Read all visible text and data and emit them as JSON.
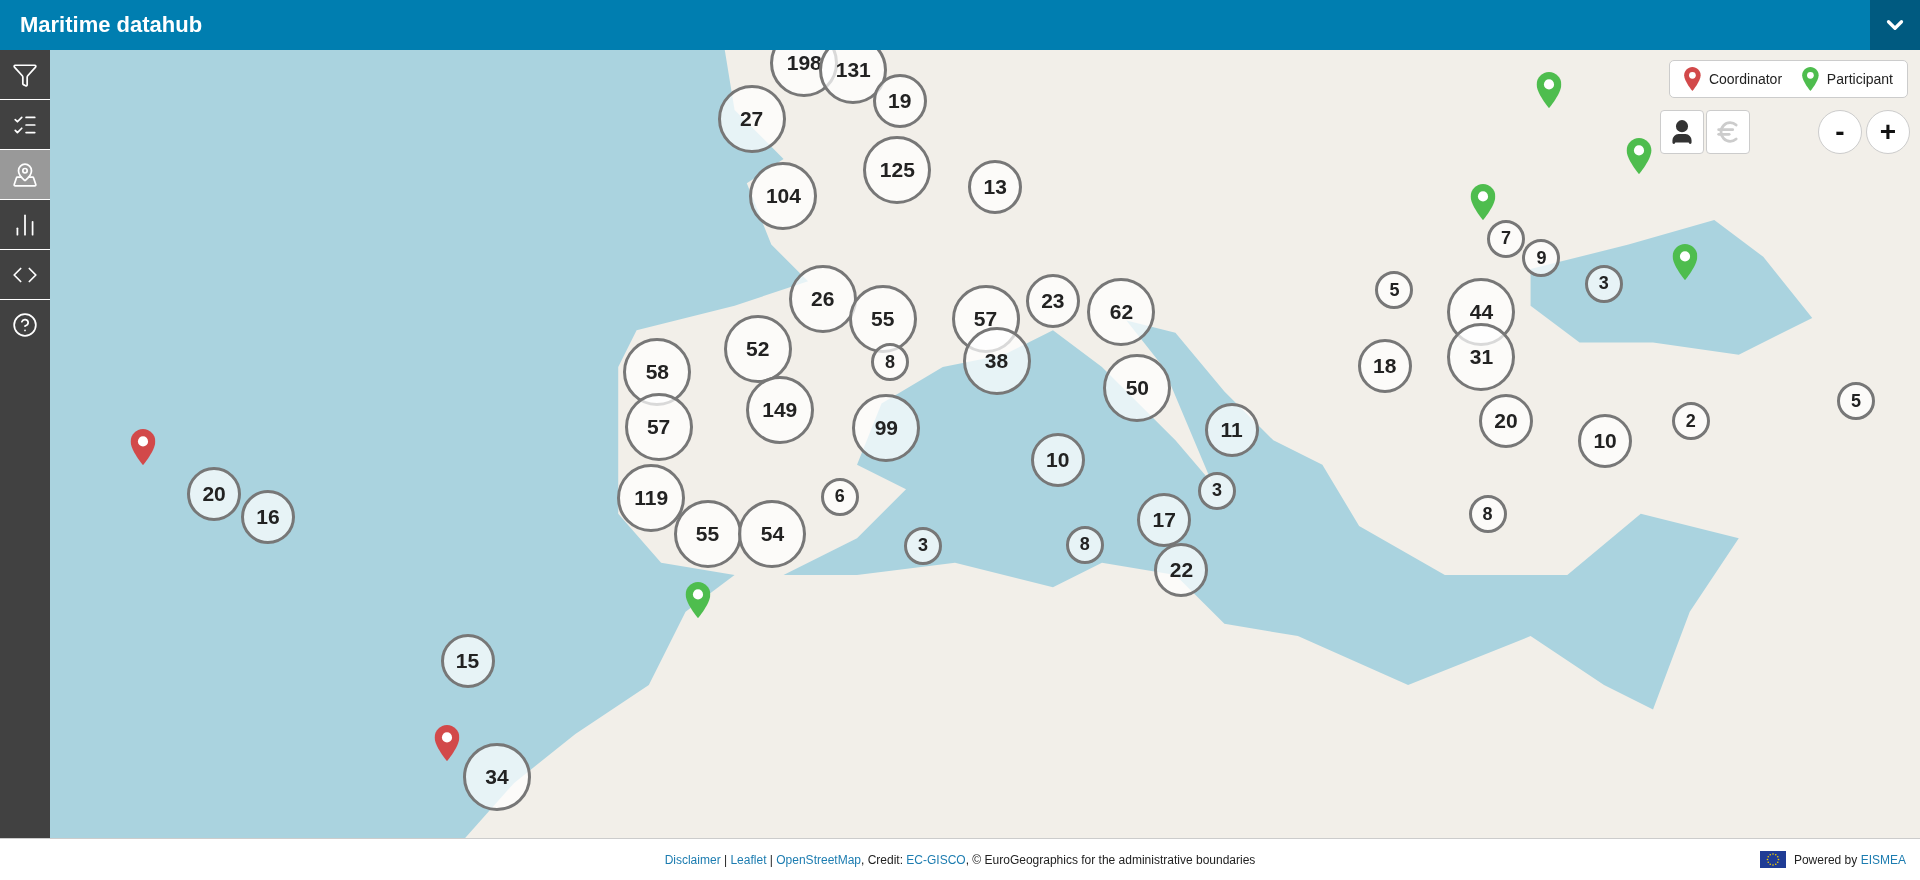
{
  "header": {
    "title": "Maritime datahub"
  },
  "sidebar": {
    "items": [
      {
        "kind": "filter",
        "selected": false
      },
      {
        "kind": "list",
        "selected": false
      },
      {
        "kind": "map",
        "selected": true
      },
      {
        "kind": "chart",
        "selected": false
      },
      {
        "kind": "code",
        "selected": false
      },
      {
        "kind": "help",
        "selected": false
      }
    ]
  },
  "legend": [
    {
      "kind": "coordinator",
      "label": "Coordinator"
    },
    {
      "kind": "participant",
      "label": "Participant"
    }
  ],
  "view_toggles": [
    {
      "kind": "person",
      "selected": true
    },
    {
      "kind": "euro",
      "selected": false
    }
  ],
  "zoom": {
    "out": "-",
    "in": "+"
  },
  "clusters": [
    "198",
    "131",
    "27",
    "19",
    "104",
    "125",
    "13",
    "7",
    "9",
    "26",
    "55",
    "57",
    "23",
    "62",
    "5",
    "44",
    "3",
    "58",
    "52",
    "8",
    "38",
    "18",
    "31",
    "50",
    "149",
    "5",
    "57",
    "99",
    "11",
    "20",
    "2",
    "10",
    "10",
    "20",
    "119",
    "6",
    "3",
    "16",
    "17",
    "8",
    "55",
    "54",
    "3",
    "8",
    "22",
    "15",
    "34"
  ],
  "pins": [
    {
      "kind": "coordinator"
    },
    {
      "kind": "coordinator"
    },
    {
      "kind": "participant"
    },
    {
      "kind": "participant"
    },
    {
      "kind": "participant"
    },
    {
      "kind": "participant"
    },
    {
      "kind": "participant"
    }
  ],
  "footer": {
    "credits": [
      {
        "kind": "link",
        "text": "Disclaimer"
      },
      {
        "kind": "text",
        "text": " | "
      },
      {
        "kind": "link",
        "text": "Leaflet"
      },
      {
        "kind": "text",
        "text": " | "
      },
      {
        "kind": "link",
        "text": "OpenStreetMap"
      },
      {
        "kind": "text",
        "text": ", Credit: "
      },
      {
        "kind": "link",
        "text": "EC-GISCO"
      },
      {
        "kind": "text",
        "text": ", © EuroGeographics for the administrative boundaries"
      }
    ],
    "powered_by": {
      "text": "Powered by",
      "link": "EISMEA"
    }
  }
}
